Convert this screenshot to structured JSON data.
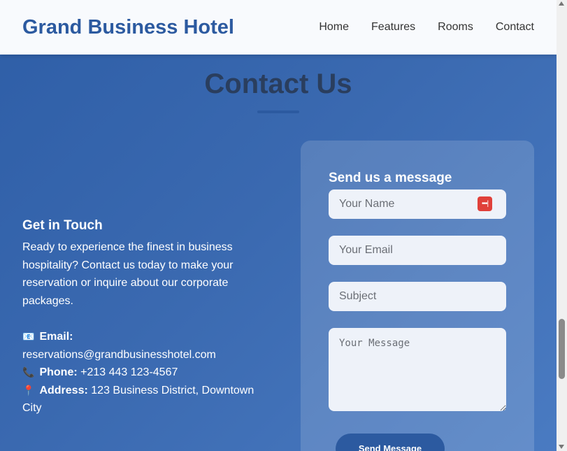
{
  "header": {
    "brand": "Grand Business Hotel",
    "nav": [
      "Home",
      "Features",
      "Rooms",
      "Contact"
    ]
  },
  "section": {
    "title": "Contact Us"
  },
  "info": {
    "heading": "Get in Touch",
    "body": "Ready to experience the finest in business hospitality? Contact us today to make your reservation or inquire about our corporate packages.",
    "email_label": "Email:",
    "email_value": "reservations@grandbusinesshotel.com",
    "phone_label": "Phone:",
    "phone_value": "+213 443 123-4567",
    "address_label": "Address:",
    "address_value": "123 Business District, Downtown City"
  },
  "form": {
    "title": "Send us a message",
    "name_placeholder": "Your Name",
    "email_placeholder": "Your Email",
    "subject_placeholder": "Subject",
    "message_placeholder": "Your Message",
    "submit_label": "Send Message"
  },
  "icons": {
    "email": "email-icon",
    "phone": "phone-icon",
    "address": "pin-icon",
    "autofill": "password-manager-icon"
  },
  "colors": {
    "brand": "#2c5aa0",
    "title": "#2a3e5e",
    "autofill": "#e0403a"
  }
}
